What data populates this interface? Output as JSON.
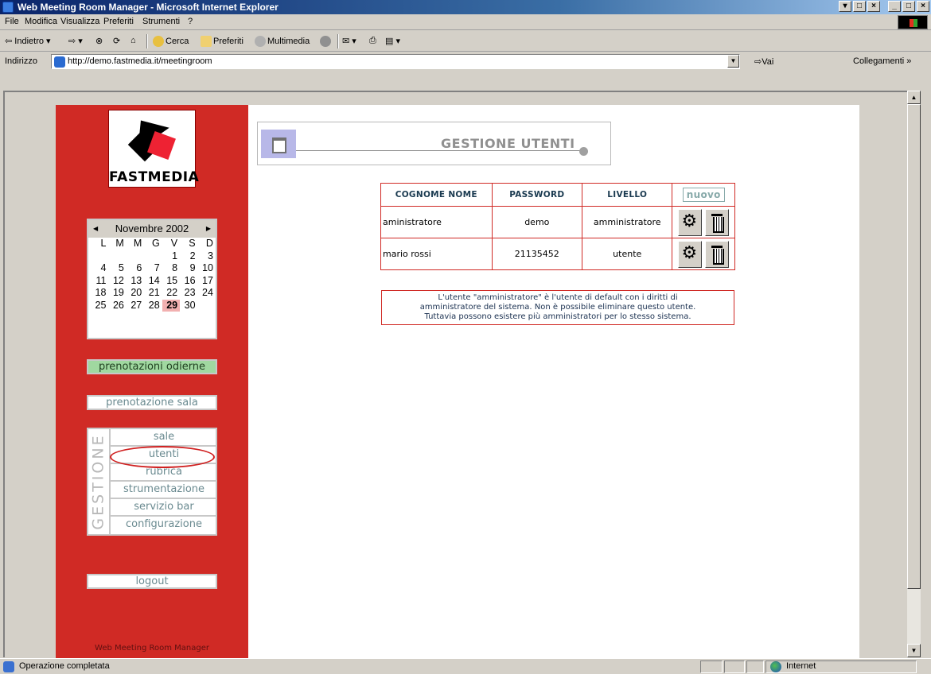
{
  "window": {
    "title": "Web Meeting Room Manager - Microsoft Internet Explorer"
  },
  "menu": [
    "File",
    "Modifica",
    "Visualizza",
    "Preferiti",
    "Strumenti",
    "?"
  ],
  "toolbar": {
    "back": "Indietro",
    "search": "Cerca",
    "favorites": "Preferiti",
    "multimedia": "Multimedia"
  },
  "address": {
    "label": "Indirizzo",
    "url": "http://demo.fastmedia.it/meetingroom",
    "go": "Vai",
    "links": "Collegamenti"
  },
  "sidebar": {
    "logo_text": "FASTMEDIA",
    "calendar": {
      "month": "Novembre 2002",
      "weekdays": [
        "L",
        "M",
        "M",
        "G",
        "V",
        "S",
        "D"
      ],
      "weeks": [
        [
          "",
          "",
          "",
          "",
          "1",
          "2",
          "3"
        ],
        [
          "4",
          "5",
          "6",
          "7",
          "8",
          "9",
          "10"
        ],
        [
          "11",
          "12",
          "13",
          "14",
          "15",
          "16",
          "17"
        ],
        [
          "18",
          "19",
          "20",
          "21",
          "22",
          "23",
          "24"
        ],
        [
          "25",
          "26",
          "27",
          "28",
          "29",
          "30",
          ""
        ]
      ],
      "today": "29"
    },
    "today_bookings": "prenotazioni odierne",
    "book_room": "prenotazione sala",
    "gestione_label": "GESTIONE",
    "gestione_items": [
      "sale",
      "utenti",
      "rubrica",
      "strumentazione",
      "servizio bar",
      "configurazione"
    ],
    "logout": "logout",
    "footer": "Web Meeting Room Manager"
  },
  "main": {
    "title": "GESTIONE UTENTI",
    "table": {
      "headers": [
        "COGNOME NOME",
        "PASSWORD",
        "LIVELLO"
      ],
      "new_button": "nuovo",
      "rows": [
        {
          "name": "aministratore",
          "password": "demo",
          "level": "amministratore"
        },
        {
          "name": "mario rossi",
          "password": "21135452",
          "level": "utente"
        }
      ]
    },
    "note_lines": [
      "L'utente \"amministratore\" è l'utente di default con i diritti di",
      "amministratore del sistema. Non è possibile eliminare questo utente.",
      "Tuttavia possono esistere più amministratori per lo stesso sistema."
    ]
  },
  "status": {
    "text": "Operazione completata",
    "zone": "Internet"
  }
}
